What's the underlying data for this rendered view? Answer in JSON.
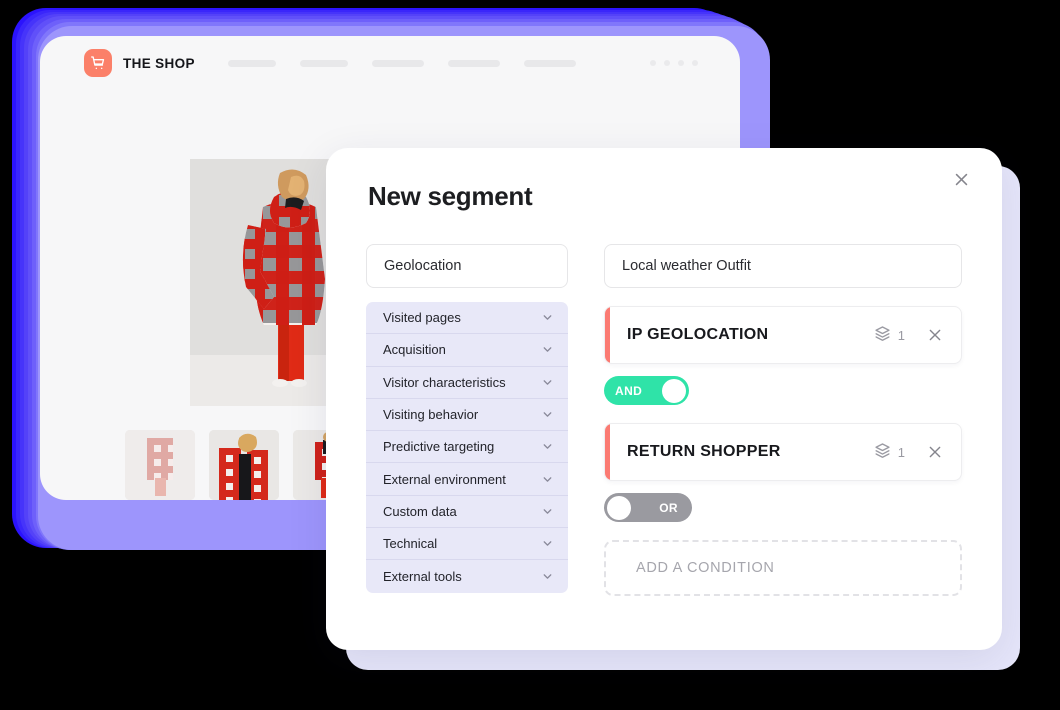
{
  "shop_window": {
    "brand_name": "THE SHOP",
    "cart_icon": "shopping-cart-icon",
    "nav_placeholder_widths": [
      48,
      48,
      52,
      52,
      52
    ],
    "header_dot_count": 4,
    "gallery": {
      "hero_alt": "Model wearing red and white buffalo plaid hooded coat with red trousers",
      "thumbnails": [
        "plaid coat back view, faded",
        "model holding plaid coat open over black top",
        "model in plaid coat with red trousers"
      ]
    }
  },
  "modal": {
    "title": "New segment",
    "close_icon": "close-icon",
    "left_column": {
      "category_select_value": "Geolocation",
      "categories": [
        {
          "label": "Visited pages",
          "chevron": "chevron-down-icon"
        },
        {
          "label": "Acquisition",
          "chevron": "chevron-down-icon"
        },
        {
          "label": "Visitor characteristics",
          "chevron": "chevron-down-icon"
        },
        {
          "label": "Visiting behavior",
          "chevron": "chevron-down-icon"
        },
        {
          "label": "Predictive targeting",
          "chevron": "chevron-down-icon"
        },
        {
          "label": "External environment",
          "chevron": "chevron-down-icon"
        },
        {
          "label": "Custom data",
          "chevron": "chevron-down-icon"
        },
        {
          "label": "Technical",
          "chevron": "chevron-down-icon"
        },
        {
          "label": "External tools",
          "chevron": "chevron-down-icon"
        }
      ]
    },
    "right_column": {
      "segment_name_value": "Local weather Outfit",
      "conditions": [
        {
          "name": "IP GEOLOCATION",
          "layers_icon": "layers-icon",
          "layers_count": "1",
          "close_icon": "close-icon"
        },
        {
          "name": "RETURN SHOPPER",
          "layers_icon": "layers-icon",
          "layers_count": "1",
          "close_icon": "close-icon"
        }
      ],
      "operators": [
        {
          "label": "AND",
          "state": "on"
        },
        {
          "label": "OR",
          "state": "off"
        }
      ],
      "add_condition_label": "ADD A CONDITION"
    }
  },
  "colors": {
    "accent_blue": "#2b13fd",
    "blue_mid": "#5a52f5",
    "blue_light": "#8f87fb",
    "lavender_shadow": "#e6e6fa",
    "cart_orange": "#fb8069",
    "condition_accent": "#fb7a72",
    "toggle_on_green": "#2fe3a8",
    "toggle_off_gray": "#9a9aa0",
    "category_bg": "#e8e8f8"
  }
}
